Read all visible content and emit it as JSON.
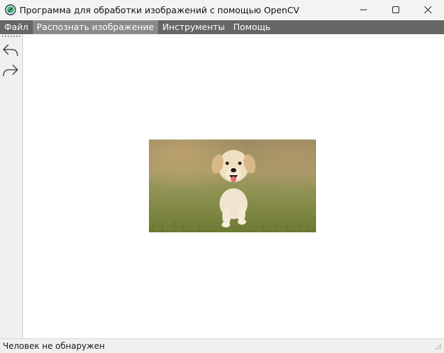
{
  "window": {
    "title": "Программа для обработки изображений с помощью OpenCV"
  },
  "menu": [
    {
      "label": "Файл"
    },
    {
      "label": "Распознать изображение"
    },
    {
      "label": "Инструменты"
    },
    {
      "label": "Помощь"
    }
  ],
  "toolbar": {
    "undo_icon": "undo-arrow-icon",
    "redo_icon": "redo-arrow-icon"
  },
  "image": {
    "subject": "puppy-photo"
  },
  "status": {
    "text": "Человек не обнаружен"
  },
  "colors": {
    "menubar": "#666666",
    "menu_active": "#8a8a8a",
    "titlebar": "#f3f3f3"
  }
}
